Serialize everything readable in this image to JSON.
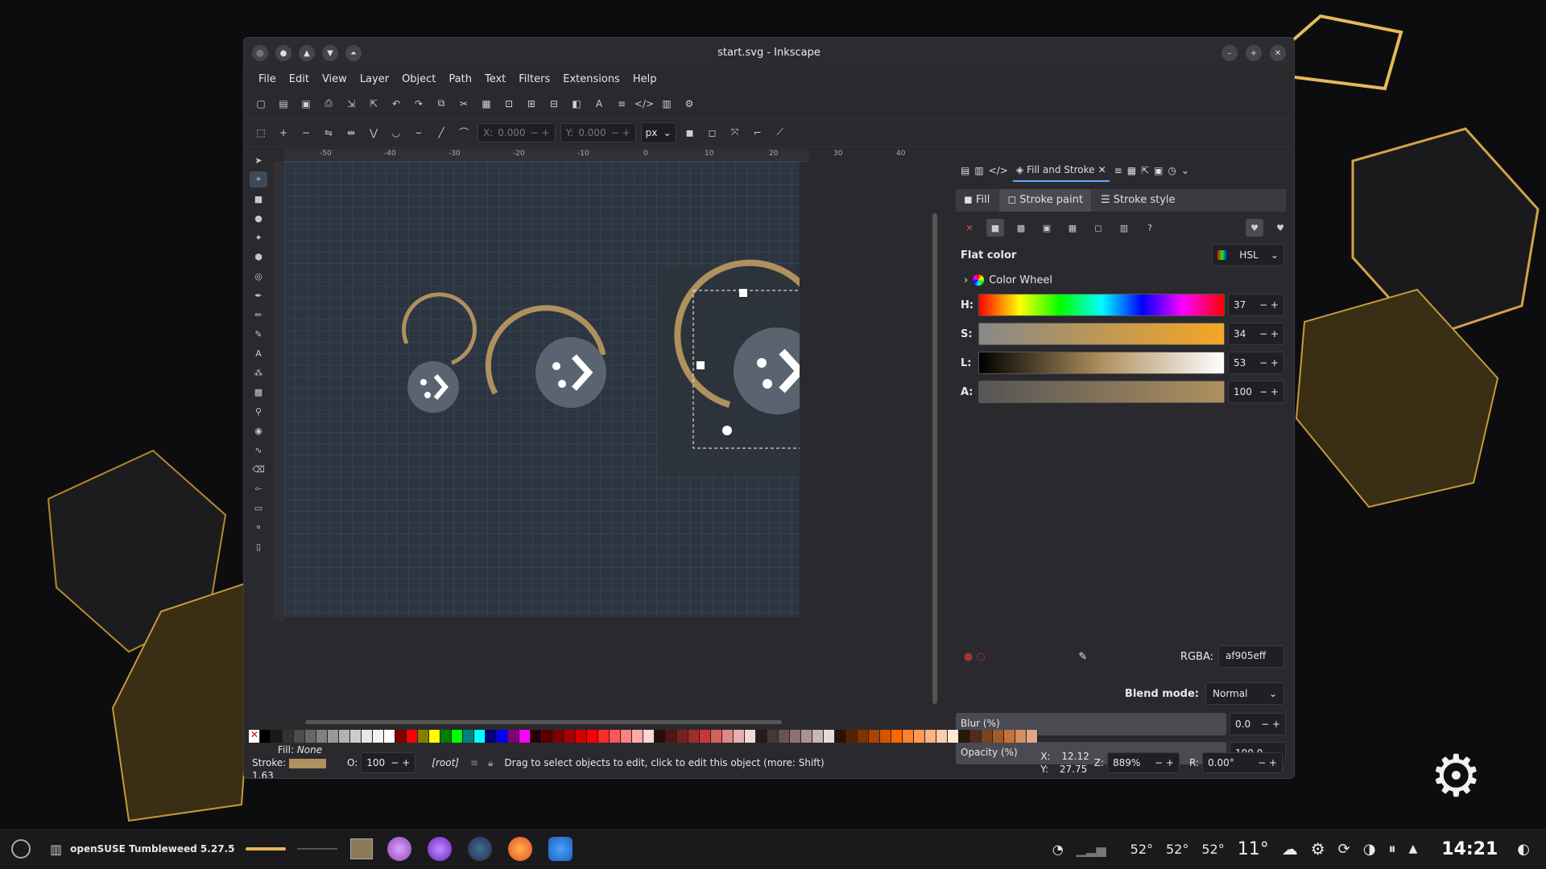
{
  "window": {
    "title": "start.svg - Inkscape"
  },
  "menu": [
    "File",
    "Edit",
    "View",
    "Layer",
    "Object",
    "Path",
    "Text",
    "Filters",
    "Extensions",
    "Help"
  ],
  "toolbar2": {
    "x_label": "X:",
    "x_value": "0.000",
    "y_label": "Y:",
    "y_value": "0.000",
    "unit": "px"
  },
  "ruler": {
    "ticks": [
      "-50",
      "-40",
      "-30",
      "-20",
      "-10",
      "0",
      "10",
      "20",
      "30",
      "40"
    ]
  },
  "panel": {
    "tab_label": "Fill and Stroke",
    "subtabs": [
      "Fill",
      "Stroke paint",
      "Stroke style"
    ],
    "flat_color": "Flat color",
    "mode": "HSL",
    "color_wheel": "Color Wheel",
    "sliders": [
      {
        "label": "H:",
        "value": "37"
      },
      {
        "label": "S:",
        "value": "34"
      },
      {
        "label": "L:",
        "value": "53"
      },
      {
        "label": "A:",
        "value": "100"
      }
    ],
    "rgba_label": "RGBA:",
    "rgba_value": "af905eff",
    "blend_label": "Blend mode:",
    "blend_value": "Normal",
    "blur_label": "Blur (%)",
    "blur_value": "0.0",
    "opacity_label": "Opacity (%)",
    "opacity_value": "100.0"
  },
  "colors": {
    "accent_stroke": "#af905e",
    "canvas": "#2c3540"
  },
  "status": {
    "fill_label": "Fill:",
    "fill_value": "None",
    "stroke_label": "Stroke:",
    "stroke_width": "1.63",
    "opacity_label": "O:",
    "opacity_value": "100",
    "layer": "[root]",
    "message": "Drag to select objects to edit, click to edit this object (more: Shift)",
    "x_label": "X:",
    "x_value": "12.12",
    "y_label": "Y:",
    "y_value": "27.75",
    "zoom_label": "Z:",
    "zoom_value": "889%",
    "rotate_label": "R:",
    "rotate_value": "0.00°"
  },
  "taskbar": {
    "os_label": "openSUSE Tumbleweed 5.27.5",
    "temps": [
      "52°",
      "52°",
      "52°"
    ],
    "weather": "11°",
    "clock": "14:21"
  }
}
